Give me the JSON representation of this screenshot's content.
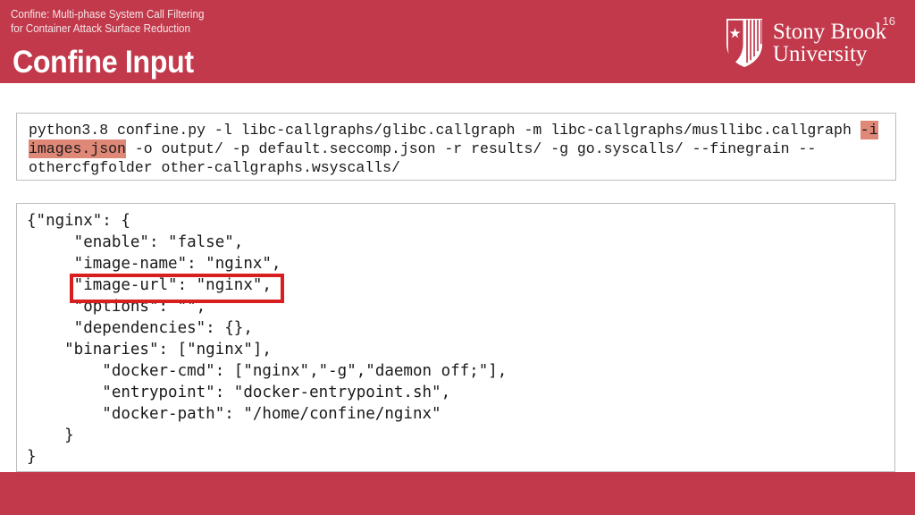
{
  "header": {
    "title": "Confine Input",
    "background_color": "#c1394b",
    "logo": {
      "icon": "stony-brook-shield-icon",
      "line1": "Stony Brook",
      "line2": "University"
    }
  },
  "command_block": {
    "highlight_color": "#e08878",
    "segments": [
      {
        "text": "python3.8 confine.py -l libc-callgraphs/glibc.callgraph -m libc-callgraphs/musllibc.callgraph ",
        "highlighted": false
      },
      {
        "text": "-i images.json",
        "highlighted": true
      },
      {
        "text": " -o output/ -p default.seccomp.json -r results/ -g go.syscalls/ --finegrain --othercfgfolder other-callgraphs.wsyscalls/",
        "highlighted": false
      }
    ],
    "full_text": "python3.8 confine.py -l libc-callgraphs/glibc.callgraph -m libc-callgraphs/musllibc.callgraph -i images.json -o output/ -p default.seccomp.json -r results/ -g go.syscalls/ --finegrain --othercfgfolder other-callgraphs.wsyscalls/"
  },
  "json_block": {
    "highlight_border_color": "#d81e1e",
    "highlighted_line": "\"image-url\": \"nginx\",",
    "lines": [
      "{\"nginx\": {",
      "     \"enable\": \"false\",",
      "     \"image-name\": \"nginx\",",
      "     \"image-url\": \"nginx\",",
      "     \"options\": \"\",",
      "     \"dependencies\": {},",
      "    \"binaries\": [\"nginx\"],",
      "        \"docker-cmd\": [\"nginx\",\"-g\",\"daemon off;\"],",
      "        \"entrypoint\": \"docker-entrypoint.sh\",",
      "        \"docker-path\": \"/home/confine/nginx\"",
      "    }",
      "}"
    ],
    "text": "{\"nginx\": {\n     \"enable\": \"false\",\n     \"image-name\": \"nginx\",\n     \"image-url\": \"nginx\",\n     \"options\": \"\",\n     \"dependencies\": {},\n    \"binaries\": [\"nginx\"],\n        \"docker-cmd\": [\"nginx\",\"-g\",\"daemon off;\"],\n        \"entrypoint\": \"docker-entrypoint.sh\",\n        \"docker-path\": \"/home/confine/nginx\"\n    }\n}"
  },
  "footer": {
    "line1": "Confine: Multi-phase System Call Filtering",
    "line2": "for Container Attack Surface Reduction",
    "page_number": "16",
    "background_color": "#c1394b"
  }
}
